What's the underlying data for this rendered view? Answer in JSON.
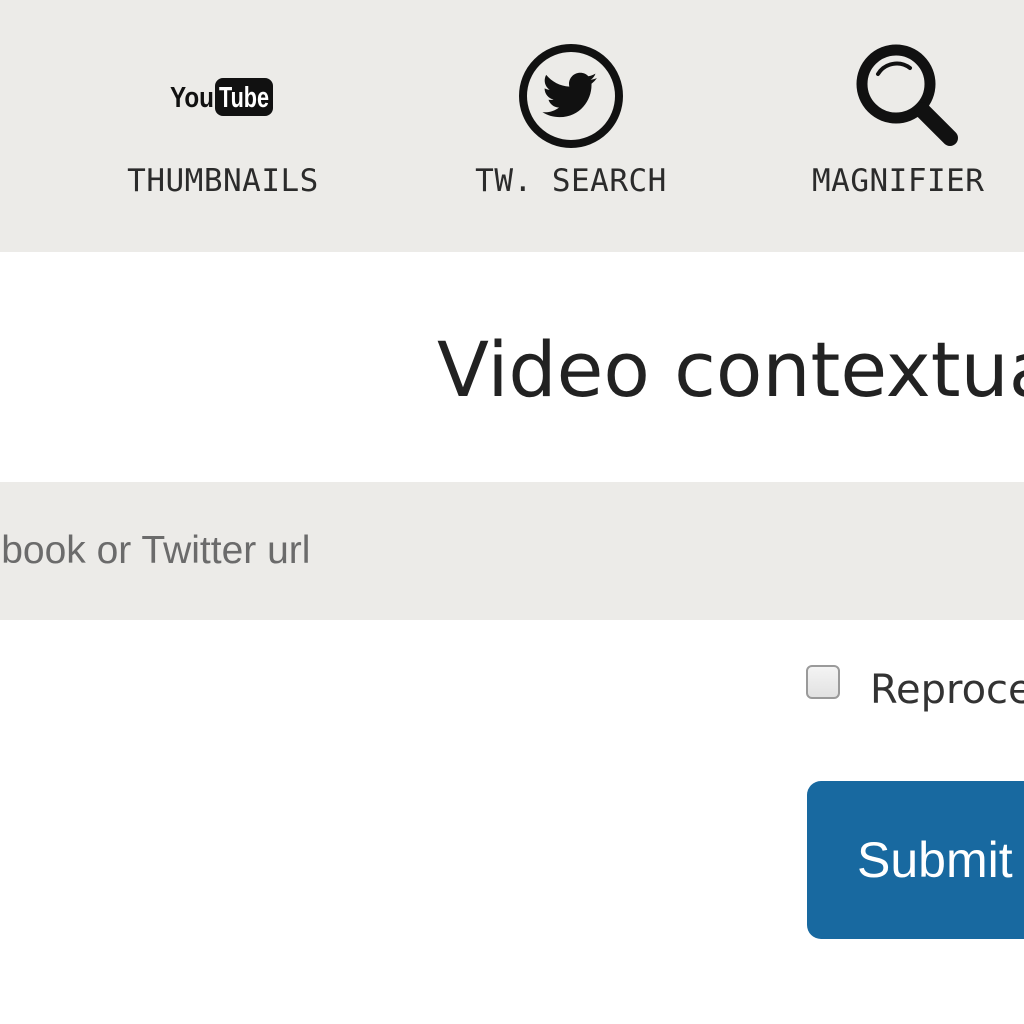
{
  "nav": {
    "items": [
      {
        "label": "THUMBNAILS",
        "icon": "youtube-logo-icon",
        "logo_text": [
          "You",
          "Tube"
        ]
      },
      {
        "label": "TW. SEARCH",
        "icon": "twitter-bird-icon"
      },
      {
        "label": "MAGNIFIER",
        "icon": "magnifier-icon"
      }
    ]
  },
  "main": {
    "title": "Video contextua",
    "url_input": {
      "value": "",
      "placeholder": "cebook or Twitter url"
    },
    "reprocess": {
      "label": "Reproce",
      "checked": false
    },
    "submit_label": "Submit"
  },
  "colors": {
    "nav_background": "#ecebe8",
    "input_background": "#ecebe8",
    "button_primary": "#1869a0",
    "text_dark": "#222222"
  }
}
